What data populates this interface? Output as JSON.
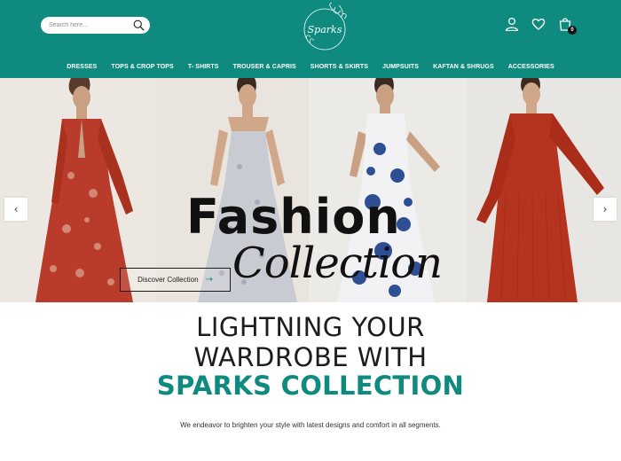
{
  "header": {
    "search_placeholder": "Search here...",
    "logo_text": "Sparks",
    "cart_count": "0",
    "background": "#0f8a7e"
  },
  "icons": {
    "search": "search-icon",
    "account": "user-icon",
    "wishlist": "heart-icon",
    "cart": "shopping-bag-icon",
    "prev": "chevron-left-icon",
    "next": "chevron-right-icon",
    "discover": "arrow-right-icon"
  },
  "nav": {
    "items": [
      "DRESSES",
      "TOPS & CROP TOPS",
      "T- SHIRTS",
      "TROUSER & CAPRIS",
      "SHORTS & SKIRTS",
      "JUMPSUITS",
      "KAFTAN & SHRUGS",
      "ACCESSORIES"
    ]
  },
  "hero": {
    "title": "Fashion",
    "script": "Collection",
    "cta_label": "Discover Collection",
    "dress_colors": [
      "#b93b2c",
      "#c9cbd2",
      "#2e4f94",
      "#b5341f"
    ]
  },
  "content": {
    "headline_line1": "LIGHTNING YOUR",
    "headline_line2": "WARDROBE WITH",
    "headline_accent": "SPARKS COLLECTION",
    "tagline": "We endeavor to brighten your style with latest designs and comfort in all segments.",
    "accent_color": "#0f8a7e"
  }
}
